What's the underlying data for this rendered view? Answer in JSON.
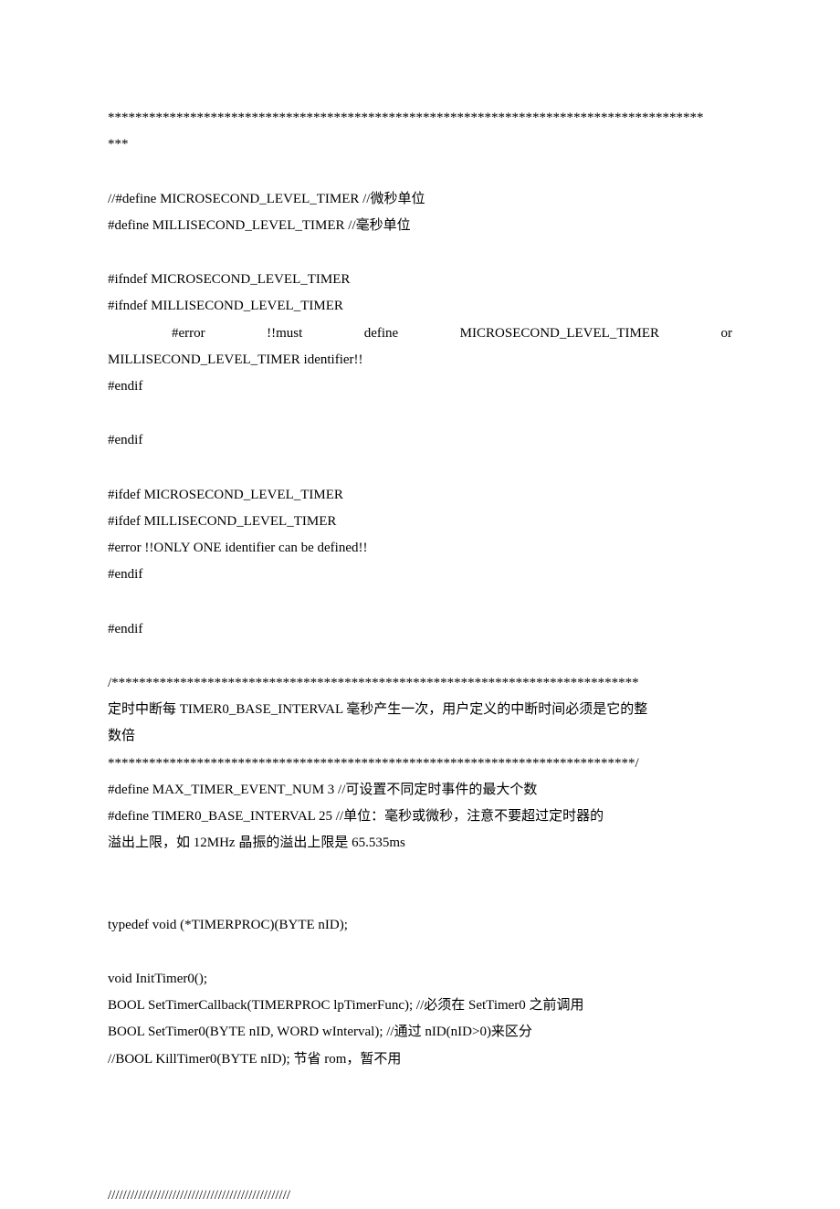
{
  "lines": {
    "l01": "***************************************************************************************",
    "l02": "***",
    "l03": "//#define MICROSECOND_LEVEL_TIMER      //微秒单位",
    "l04": "#define MILLISECOND_LEVEL_TIMER   //毫秒单位",
    "l05": "#ifndef MICROSECOND_LEVEL_TIMER",
    "l06": "       #ifndef MILLISECOND_LEVEL_TIMER",
    "l07a": "#error",
    "l07b": "!!must",
    "l07c": "define",
    "l07d": "MICROSECOND_LEVEL_TIMER",
    "l07e": "or",
    "l08": "MILLISECOND_LEVEL_TIMER identifier!!",
    "l09": "       #endif",
    "l10": "#endif",
    "l11": "#ifdef MICROSECOND_LEVEL_TIMER",
    "l12": "       #ifdef MILLISECOND_LEVEL_TIMER",
    "l13": "              #error !!ONLY ONE identifier can be defined!!",
    "l14": "       #endif",
    "l15": "#endif",
    "l16": "/*****************************************************************************",
    "l17": "定时中断每 TIMER0_BASE_INTERVAL 毫秒产生一次，用户定义的中断时间必须是它的整",
    "l18": "数倍",
    "l19": "*****************************************************************************/",
    "l20": "#define MAX_TIMER_EVENT_NUM 3                 //可设置不同定时事件的最大个数",
    "l21": "#define TIMER0_BASE_INTERVAL 25          //单位：毫秒或微秒，注意不要超过定时器的",
    "l22": "溢出上限，如 12MHz 晶振的溢出上限是 65.535ms",
    "l23": "typedef void (*TIMERPROC)(BYTE nID);",
    "l24": "void InitTimer0();",
    "l25": "BOOL SetTimerCallback(TIMERPROC lpTimerFunc); //必须在 SetTimer0 之前调用",
    "l26": "BOOL SetTimer0(BYTE nID, WORD wInterval); //通过 nID(nID>0)来区分",
    "l27": "//BOOL KillTimer0(BYTE nID);  节省 rom，暂不用",
    "l28": "////////////////////////////////////////////////"
  }
}
